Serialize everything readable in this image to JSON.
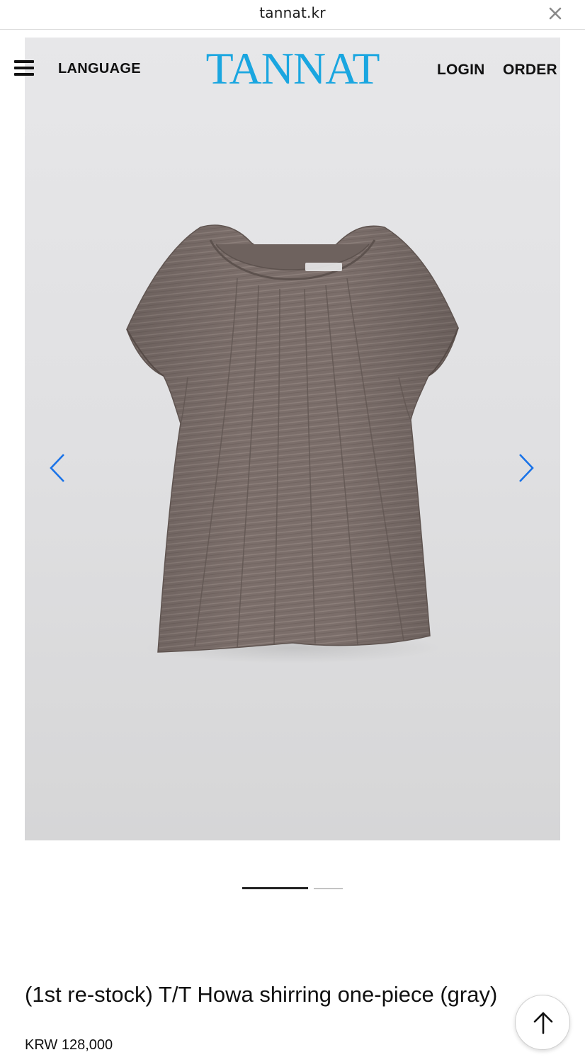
{
  "browser": {
    "url": "tannat.kr",
    "close_icon": "close-icon"
  },
  "header": {
    "menu_icon": "hamburger-menu-icon",
    "language_label": "LANGUAGE",
    "logo_text": "TANNAT",
    "login_label": "LOGIN",
    "order_label": "ORDER"
  },
  "gallery": {
    "prev_icon": "chevron-left-icon",
    "next_icon": "chevron-right-icon",
    "current_slide": 1,
    "total_slides": 2,
    "image_subject": "gray shirring one-piece"
  },
  "product": {
    "title": "(1st re-stock) T/T Howa shirring one-piece (gray)",
    "price": "KRW 128,000"
  },
  "scroll_top": {
    "icon": "arrow-up-icon"
  },
  "colors": {
    "logo": "#1aa6e0",
    "arrows": "#1a73e8",
    "garment": "#7d706c",
    "background": "#e2e2e4"
  }
}
